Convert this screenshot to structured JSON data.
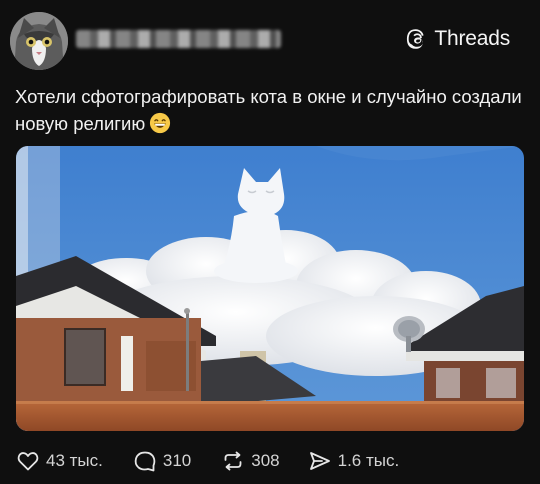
{
  "header": {
    "avatar_icon": "cat-avatar",
    "brand": {
      "icon": "threads-logo-icon",
      "name": "Threads"
    }
  },
  "post": {
    "text": "Хотели сфотографировать кота в окне и случайно создали новую религию",
    "emoji_icon": "grinning-face-emoji",
    "image_icon": "cat-reflection-cloud-photo"
  },
  "actions": {
    "like": {
      "icon": "heart-icon",
      "count": "43 тыс."
    },
    "reply": {
      "icon": "comment-icon",
      "count": "310"
    },
    "repost": {
      "icon": "repost-icon",
      "count": "308"
    },
    "share": {
      "icon": "send-icon",
      "count": "1.6 тыс."
    }
  },
  "colors": {
    "background": "#0f0f0f",
    "text": "#f3f3f3",
    "muted": "#d4d4d4"
  }
}
